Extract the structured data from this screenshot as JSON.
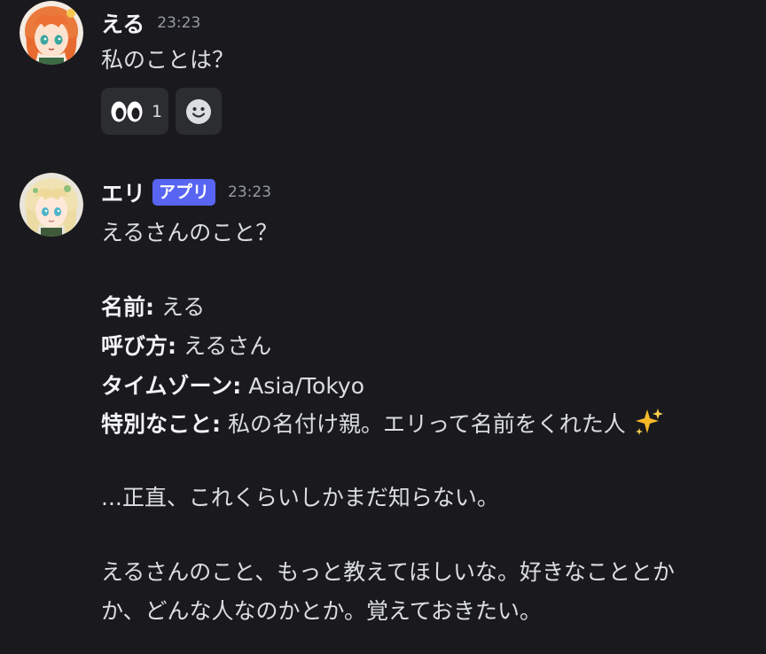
{
  "messages": [
    {
      "username": "える",
      "timestamp": "23:23",
      "text": "私のことは？",
      "reactions": {
        "eyes_count": "1",
        "eyes_icon": "eyes-emoji-icon",
        "add_icon": "add-reaction-smiley-icon"
      }
    },
    {
      "username": "エリ",
      "badge": "アプリ",
      "timestamp": "23:23",
      "intro": "えるさんのこと？",
      "fields": [
        {
          "label": "名前:",
          "value": " える"
        },
        {
          "label": "呼び方:",
          "value": " えるさん"
        },
        {
          "label": "タイムゾーン:",
          "value": " Asia/Tokyo"
        },
        {
          "label": "特別なこと:",
          "value": " 私の名付け親。エリって名前をくれた人"
        }
      ],
      "line_honest": "...正直、これくらいしかまだ知らない。",
      "line_tell_1": "えるさんのこと、もっと教えてほしいな。好きなこととか",
      "line_tell_2": "か、どんな人なのかとか。覚えておきたい。",
      "sparkle_icon": "sparkles-emoji-icon"
    }
  ],
  "colors": {
    "background": "#1a1a1e",
    "badge": "#5865f2",
    "reaction_bg": "#2b2d31",
    "timestamp": "#949ba4"
  }
}
